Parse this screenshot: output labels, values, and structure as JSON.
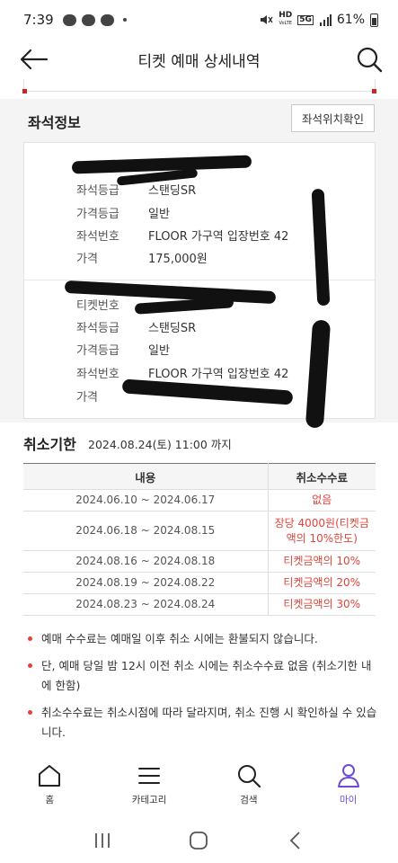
{
  "status_bar": {
    "time": "7:39",
    "network_label_top": "HD",
    "network_label_bottom": "VoLTE",
    "net_badge": "5G",
    "battery": "61%"
  },
  "header": {
    "title": "티켓 예매 상세내역"
  },
  "seat_info": {
    "title": "좌석정보",
    "location_button": "좌석위치확인",
    "groups": [
      {
        "rows": [
          {
            "label": "좌석등급",
            "value": "스탠딩SR"
          },
          {
            "label": "가격등급",
            "value": "일반"
          },
          {
            "label": "좌석번호",
            "value": "FLOOR 가구역 입장번호 42"
          },
          {
            "label": "가격",
            "value": "175,000원"
          }
        ]
      },
      {
        "rows": [
          {
            "label": "티켓번호",
            "value": ""
          },
          {
            "label": "좌석등급",
            "value": "스탠딩SR"
          },
          {
            "label": "가격등급",
            "value": "일반"
          },
          {
            "label": "좌석번호",
            "value": "FLOOR 가구역 입장번호 42"
          },
          {
            "label": "가격",
            "value": ""
          }
        ]
      }
    ]
  },
  "cancel": {
    "title": "취소기한",
    "deadline": "2024.08.24(토) 11:00 까지",
    "table": {
      "headers": [
        "내용",
        "취소수수료"
      ],
      "rows": [
        {
          "period": "2024.06.10 ~ 2024.06.17",
          "fee": "없음"
        },
        {
          "period": "2024.06.18 ~ 2024.08.15",
          "fee_line1": "장당 4000원(티켓금",
          "fee_line2": "액의 10%한도)"
        },
        {
          "period": "2024.08.16 ~ 2024.08.18",
          "fee": "티켓금액의 10%"
        },
        {
          "period": "2024.08.19 ~ 2024.08.22",
          "fee": "티켓금액의 20%"
        },
        {
          "period": "2024.08.23 ~ 2024.08.24",
          "fee": "티켓금액의 30%"
        }
      ]
    }
  },
  "notes": [
    "예매 수수료는 예매일 이후 취소 시에는 환불되지 않습니다.",
    "단, 예매 당일 밤 12시 이전 취소 시에는 취소수수료 없음 (취소기한 내에 한함)",
    "취소수수료는 취소시점에 따라 달라지며, 취소 진행 시 확인하실 수 있습니다."
  ],
  "bottom_nav": [
    {
      "label": "홈",
      "icon": "home-icon",
      "active": false
    },
    {
      "label": "카테고리",
      "icon": "menu-icon",
      "active": false
    },
    {
      "label": "검색",
      "icon": "search-icon",
      "active": false
    },
    {
      "label": "마이",
      "icon": "person-icon",
      "active": true
    }
  ],
  "colors": {
    "accent_purple": "#6d4bd8",
    "fee_red": "#e0443a",
    "background_gray": "#f4f4f4"
  }
}
